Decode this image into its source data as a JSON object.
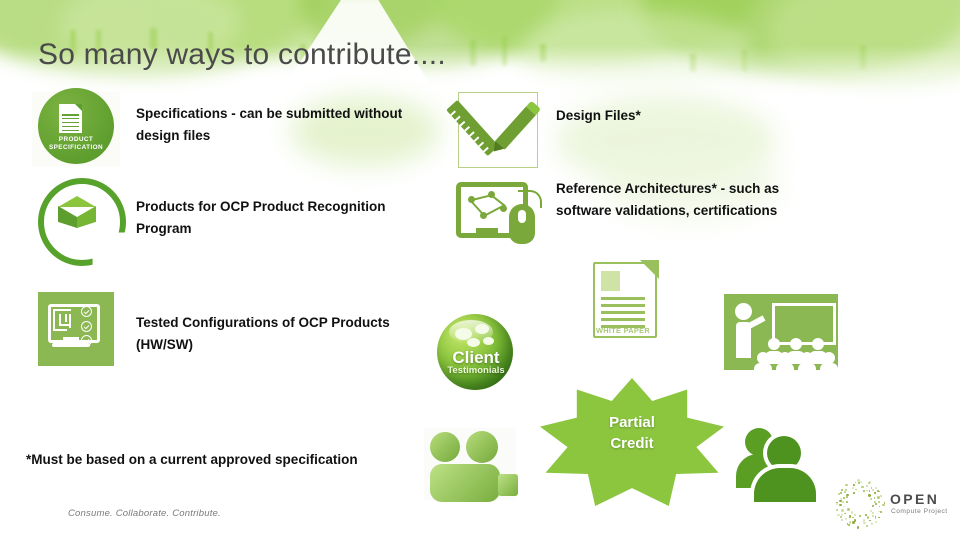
{
  "slide": {
    "title": "So many ways to contribute....",
    "footnote": "*Must be based on a current approved specification",
    "tagline": "Consume. Collaborate. Contribute."
  },
  "items": [
    {
      "id": "specifications",
      "icon": "product-specification-icon",
      "icon_caption_line1": "PRODUCT",
      "icon_caption_line2": "SPECIFICATION",
      "text": "Specifications - can be submitted without design files"
    },
    {
      "id": "design-files",
      "icon": "pencil-ruler-icon",
      "text": "Design Files*"
    },
    {
      "id": "ocp-product-recognition",
      "icon": "cube-ring-icon",
      "text": "Products for OCP Product Recognition Program"
    },
    {
      "id": "reference-architectures",
      "icon": "monitor-mouse-icon",
      "text": "Reference Architectures* - such as software validations, certifications"
    },
    {
      "id": "tested-configurations",
      "icon": "monitor-checklist-icon",
      "text": "Tested Configurations of OCP Products (HW/SW)"
    }
  ],
  "graphics": {
    "client_testimonials": {
      "icon": "client-testimonials-sphere-icon",
      "line1": "Client",
      "line2": "Testimonials"
    },
    "white_paper": {
      "icon": "white-paper-icon",
      "caption": "WHITE PAPER"
    },
    "training": {
      "icon": "training-presentation-icon"
    },
    "group": {
      "icon": "user-group-icon"
    },
    "community": {
      "icon": "community-people-icon"
    },
    "star": {
      "icon": "starburst-icon",
      "line1": "Partial",
      "line2": "Credit"
    }
  },
  "logo": {
    "name": "ocp-logo",
    "word": "OPEN",
    "sub": "Compute Project"
  },
  "colors": {
    "brand_green": "#8cc63f",
    "dark_green": "#5e9e2e",
    "olive": "#7aa83a",
    "star_outline": "#1f2d57",
    "title_gray": "#4a4a4a"
  }
}
